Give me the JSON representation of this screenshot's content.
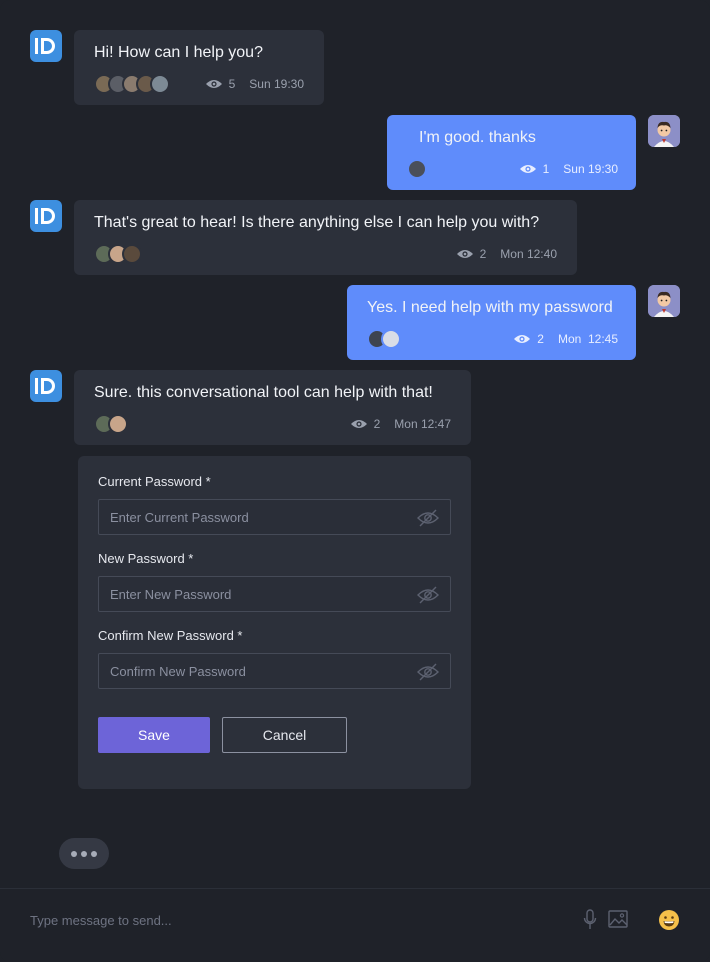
{
  "colors": {
    "background": "#1f2229",
    "bot_bubble": "#2c303a",
    "user_bubble": "#5f8cfb",
    "bot_avatar": "#3d8fe0",
    "save_button": "#6d64d8"
  },
  "messages": [
    {
      "sender": "bot",
      "text": "Hi! How can I help you?",
      "views": "5",
      "time": "Sun 19:30"
    },
    {
      "sender": "user",
      "text": "I'm good. thanks",
      "views": "1",
      "time": "Sun 19:30"
    },
    {
      "sender": "bot",
      "text": "That's great to hear! Is there anything else I can help you with?",
      "views": "2",
      "time": "Mon 12:40"
    },
    {
      "sender": "user",
      "text": "Yes. I need help with my password",
      "views": "2",
      "time": "Mon  12:45"
    },
    {
      "sender": "bot",
      "text": "Sure. this conversational tool can help with that!",
      "views": "2",
      "time": "Mon 12:47"
    }
  ],
  "bot_avatar_label": "ID",
  "form": {
    "current_label": "Current Password *",
    "current_placeholder": "Enter Current Password",
    "new_label": "New Password *",
    "new_placeholder": "Enter New Password",
    "confirm_label": "Confirm New Password *",
    "confirm_placeholder": "Confirm New Password",
    "save_label": "Save",
    "cancel_label": "Cancel",
    "toggle_icon": "eye-off-icon"
  },
  "composer": {
    "placeholder": "Type message to send...",
    "icons": [
      "microphone-icon",
      "image-icon",
      "emoji-icon"
    ]
  }
}
